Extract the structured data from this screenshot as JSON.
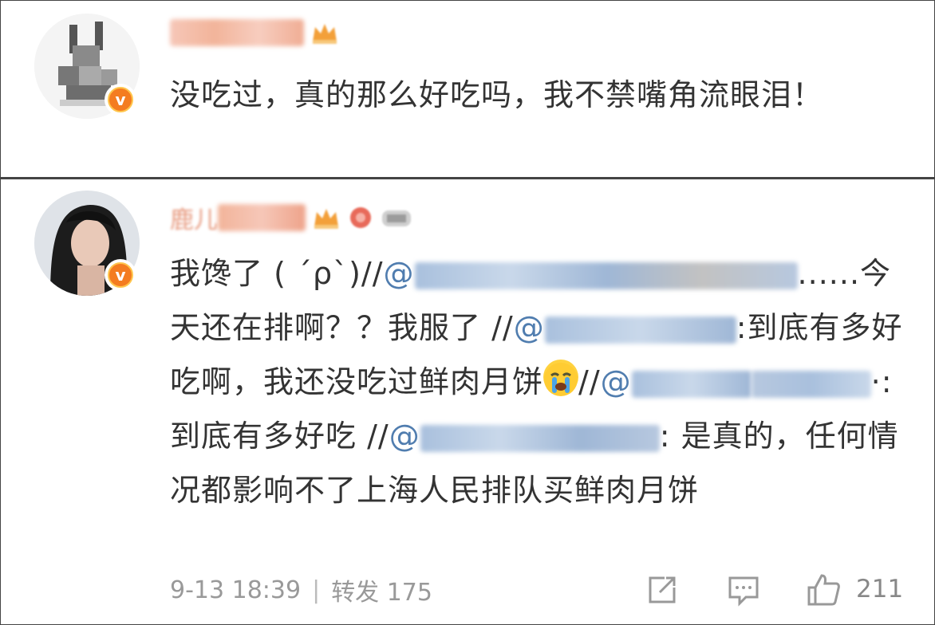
{
  "comments": [
    {
      "username": "",
      "text": "没吃过，真的那么好吃吗，我不禁嘴角流眼泪！"
    },
    {
      "username": "鹿儿",
      "text_parts": {
        "p1": "我馋了 ( ´ρ`)//",
        "at1": "@",
        "p2": "......今天还在排啊？？我服了 //",
        "at2": "@",
        "p3": ":到底有多好吃啊，我还没吃过鲜肉月饼",
        "p4": "//",
        "at3": "@",
        "p5": "·:到底有多好吃 //",
        "at4": "@",
        "p6": ": 是真的，任何情况都影响不了上海人民排队买鲜肉月饼"
      },
      "emoji_icon": "crying-face-emoji",
      "timestamp": "9-13 18:39",
      "separator": "|",
      "repost_label": "转发 175",
      "likes": "211"
    }
  ],
  "icons": {
    "repost": "repost-icon",
    "comment": "comment-icon",
    "like": "thumbs-up-icon",
    "verified": "v"
  },
  "colors": {
    "mention": "#507daf",
    "text": "#333333",
    "meta": "#999999",
    "badge": "#f47c20"
  }
}
